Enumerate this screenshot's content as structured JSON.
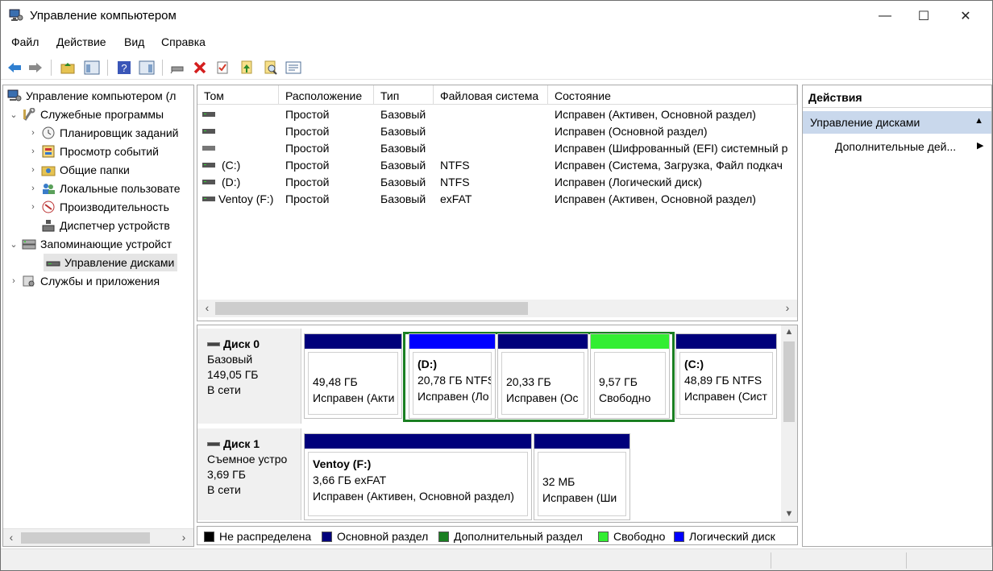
{
  "window": {
    "title": "Управление компьютером",
    "min": "—",
    "max": "☐",
    "close": "✕"
  },
  "menu": [
    "Файл",
    "Действие",
    "Вид",
    "Справка"
  ],
  "tree": [
    {
      "label": "Управление компьютером (л",
      "icon": "computer-management-icon"
    },
    {
      "label": "Служебные программы",
      "icon": "tools-icon"
    },
    {
      "label": "Планировщик заданий",
      "icon": "clock-icon"
    },
    {
      "label": "Просмотр событий",
      "icon": "event-viewer-icon"
    },
    {
      "label": "Общие папки",
      "icon": "shared-folder-icon"
    },
    {
      "label": "Локальные пользовате",
      "icon": "users-icon"
    },
    {
      "label": "Производительность",
      "icon": "performance-icon"
    },
    {
      "label": "Диспетчер устройств",
      "icon": "device-manager-icon"
    },
    {
      "label": "Запоминающие устройст",
      "icon": "storage-icon"
    },
    {
      "label": "Управление дисками",
      "icon": "disk-management-icon"
    },
    {
      "label": "Службы и приложения",
      "icon": "services-icon"
    }
  ],
  "columns": [
    "Том",
    "Расположение",
    "Тип",
    "Файловая система",
    "Состояние"
  ],
  "volumes": [
    {
      "name": "",
      "layout": "Простой",
      "type": "Базовый",
      "fs": "",
      "status": "Исправен (Активен, Основной раздел)"
    },
    {
      "name": "",
      "layout": "Простой",
      "type": "Базовый",
      "fs": "",
      "status": "Исправен (Основной раздел)"
    },
    {
      "name": "",
      "layout": "Простой",
      "type": "Базовый",
      "fs": "",
      "status": "Исправен (Шифрованный (EFI) системный р"
    },
    {
      "name": "(C:)",
      "layout": "Простой",
      "type": "Базовый",
      "fs": "NTFS",
      "status": "Исправен (Система, Загрузка, Файл подкач"
    },
    {
      "name": "(D:)",
      "layout": "Простой",
      "type": "Базовый",
      "fs": "NTFS",
      "status": "Исправен (Логический диск)"
    },
    {
      "name": "Ventoy (F:)",
      "layout": "Простой",
      "type": "Базовый",
      "fs": "exFAT",
      "status": "Исправен (Активен, Основной раздел)"
    }
  ],
  "disks": [
    {
      "name": "Диск 0",
      "kind": "Базовый",
      "size": "149,05 ГБ",
      "state": "В сети",
      "partitions": [
        {
          "title": "",
          "line1": "49,48 ГБ",
          "line2": "Исправен (Акти",
          "bar": "#00007b"
        },
        {
          "title": "(D:)",
          "line1": "20,78 ГБ NTFS",
          "line2": "Исправен (Ло",
          "bar": "#0000ff"
        },
        {
          "title": "",
          "line1": "20,33 ГБ",
          "line2": "Исправен (Ос",
          "bar": "#00007b"
        },
        {
          "title": "",
          "line1": "9,57 ГБ",
          "line2": "Свободно",
          "bar": "#33ee33"
        },
        {
          "title": "(C:)",
          "line1": "48,89 ГБ NTFS",
          "line2": "Исправен (Сист",
          "bar": "#00007b"
        }
      ]
    },
    {
      "name": "Диск 1",
      "kind": "Съемное устро",
      "size": "3,69 ГБ",
      "state": "В сети",
      "partitions": [
        {
          "title": "Ventoy  (F:)",
          "line1": "3,66 ГБ exFAT",
          "line2": "Исправен (Активен, Основной раздел)",
          "bar": "#00007b"
        },
        {
          "title": "",
          "line1": "32 МБ",
          "line2": "Исправен (Ши",
          "bar": "#00007b"
        }
      ]
    }
  ],
  "legend": [
    {
      "label": "Не распределена",
      "color": "#000000"
    },
    {
      "label": "Основной раздел",
      "color": "#00007b"
    },
    {
      "label": "Дополнительный раздел",
      "color": "#1a7f22"
    },
    {
      "label": "Свободно",
      "color": "#33ee33"
    },
    {
      "label": "Логический диск",
      "color": "#0000ff"
    }
  ],
  "actions": {
    "title": "Действия",
    "section": "Управление дисками",
    "item": "Дополнительные дей..."
  }
}
